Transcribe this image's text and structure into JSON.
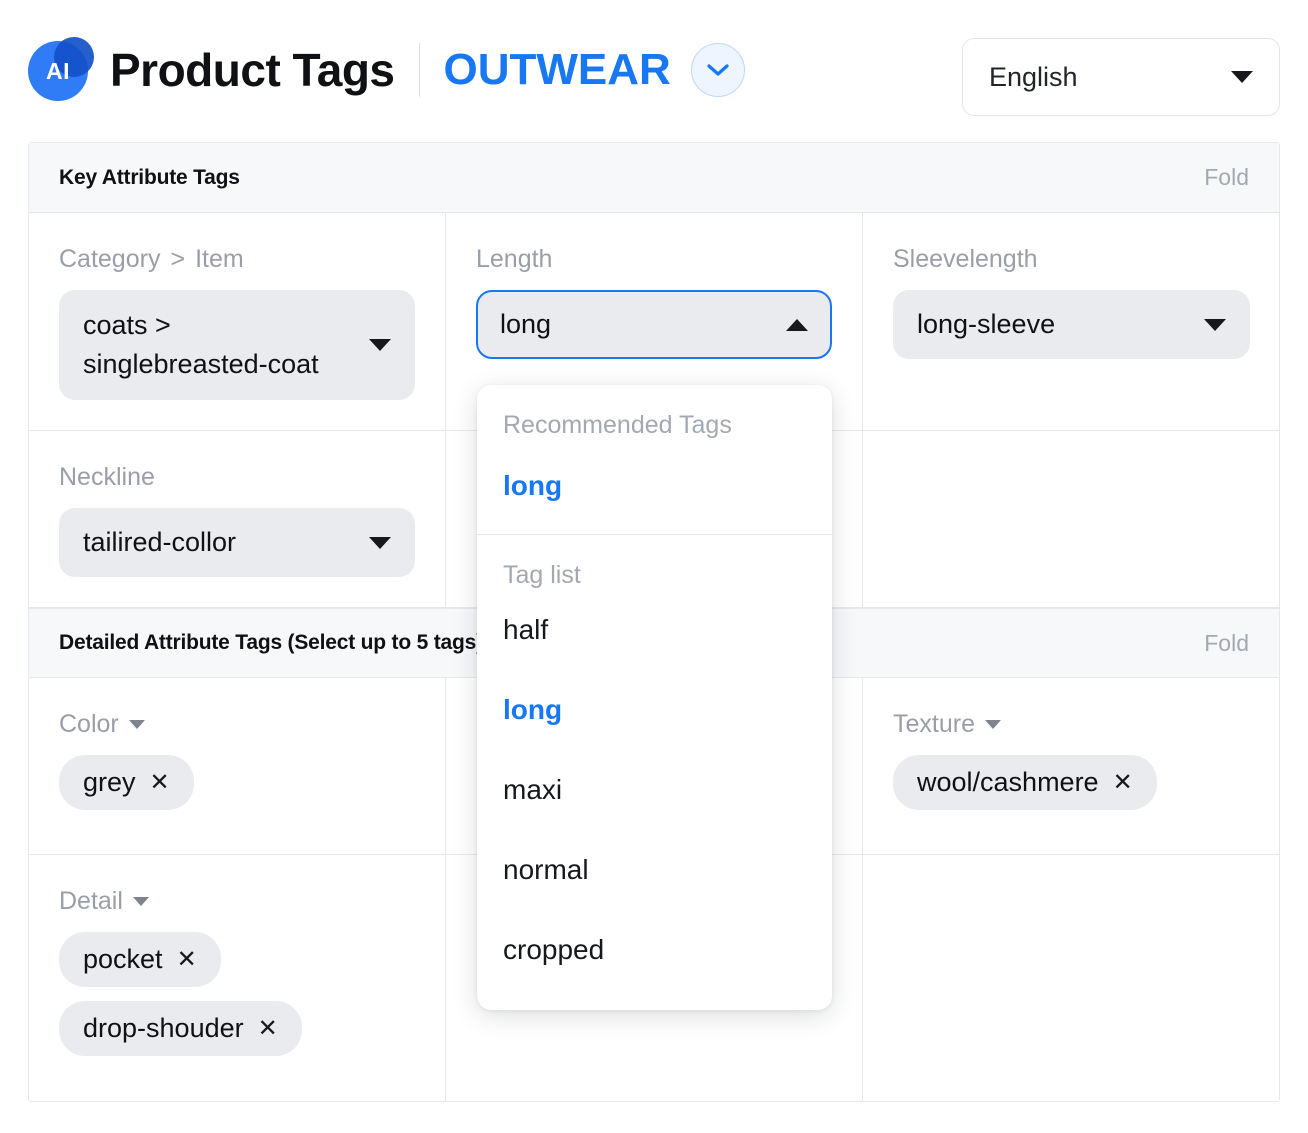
{
  "header": {
    "logo_text": "AI",
    "app_title": "Product Tags",
    "category_title": "OUTWEAR",
    "category_toggle_icon": "chevron-down-icon",
    "language": {
      "value": "English",
      "caret_icon": "caret-down-icon"
    }
  },
  "sections": [
    {
      "title": "Key Attribute Tags",
      "fold_label": "Fold",
      "fields": [
        {
          "label": "Category > Item",
          "label_parts": {
            "first": "Category",
            "separator": ">",
            "second": "Item"
          },
          "value_line1": "coats >",
          "value_line2": "singlebreasted-coat",
          "caret_icon": "caret-down-icon"
        },
        {
          "label": "Length",
          "value": "long",
          "caret_icon": "caret-up-icon",
          "focused": true
        },
        {
          "label": "Sleevelength",
          "value": "long-sleeve",
          "caret_icon": "caret-down-icon"
        },
        {
          "label": "Neckline",
          "value": "tailired-collor",
          "caret_icon": "caret-down-icon"
        }
      ]
    },
    {
      "title": "Detailed Attribute Tags (Select up to 5 tags)",
      "fold_label": "Fold",
      "fields": [
        {
          "label": "Color",
          "caret_icon": "caret-down-icon",
          "tags": [
            {
              "text": "grey",
              "remove_icon": "close-icon"
            }
          ]
        },
        {
          "label": "Texture",
          "caret_icon": "caret-down-icon",
          "tags": [
            {
              "text": "wool/cashmere",
              "remove_icon": "close-icon"
            }
          ]
        },
        {
          "label": "Detail",
          "caret_icon": "caret-down-icon",
          "tags": [
            {
              "text": "pocket",
              "remove_icon": "close-icon"
            },
            {
              "text": "drop-shouder",
              "remove_icon": "close-icon"
            }
          ]
        }
      ]
    }
  ],
  "dropdown": {
    "open_for_field": "Length",
    "recommended_label": "Recommended Tags",
    "recommended": [
      {
        "text": "long",
        "selected": true
      }
    ],
    "taglist_label": "Tag list",
    "options": [
      {
        "text": "half",
        "selected": false
      },
      {
        "text": "long",
        "selected": true
      },
      {
        "text": "maxi",
        "selected": false
      },
      {
        "text": "normal",
        "selected": false
      },
      {
        "text": "cropped",
        "selected": false
      }
    ]
  },
  "colors": {
    "accent_blue": "#1877F2",
    "pill_grey": "#E9EBEF",
    "header_grey": "#F7F8FA",
    "text_dark": "#101114",
    "text_muted": "#9A9EA8"
  }
}
